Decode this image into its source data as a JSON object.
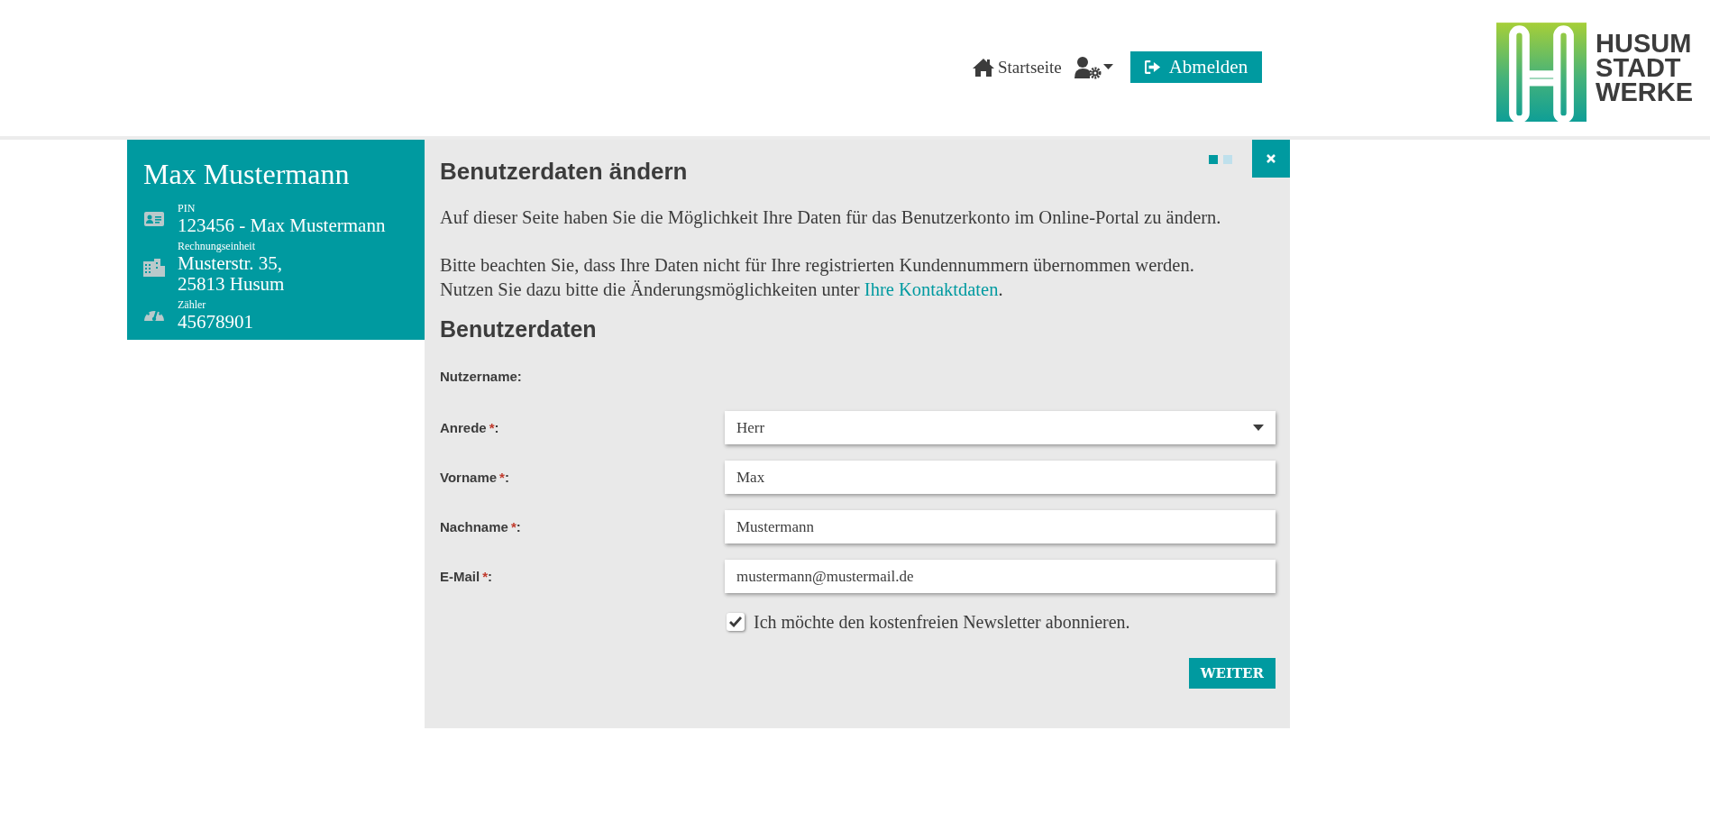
{
  "header": {
    "nav": [
      {
        "kind": "home",
        "label": "Startseite"
      },
      {
        "kind": "user_menu"
      }
    ],
    "logout": {
      "label": "Abmelden"
    },
    "logo": {
      "lines": [
        "HUSUM",
        "STADT",
        "WERKE"
      ]
    }
  },
  "sidebar": {
    "name": "Max Mustermann",
    "items": [
      {
        "kind": "id",
        "label": "PIN",
        "lines": [
          "123456 - Max Mustermann"
        ]
      },
      {
        "kind": "building",
        "label": "Rechnungseinheit",
        "lines": [
          "Musterstr. 35,",
          "25813 Husum"
        ]
      },
      {
        "kind": "meter",
        "label": "Zähler",
        "lines": [
          "45678901"
        ]
      }
    ]
  },
  "panel": {
    "title": "Benutzerdaten ändern",
    "steps": [
      {
        "selected": true
      },
      {
        "selected": false
      }
    ],
    "intro": "Auf dieser Seite haben Sie die Möglichkeit Ihre Daten für das Benutzerkonto im Online-Portal zu ändern.",
    "note": "Bitte beachten Sie, dass Ihre Daten nicht für Ihre registrierten Kundennummern übernommen werden.",
    "note2": "Nutzen Sie dazu bitte die Änderungsmöglichkeiten unter ",
    "link": "Ihre Kontaktdaten",
    "note_end": ".",
    "section": "Benutzerdaten",
    "fields": [
      {
        "kind": "static",
        "label": "Nutzername:"
      },
      {
        "kind": "select",
        "label": "Anrede",
        "mark": "*",
        "suffix": ":",
        "value": "Herr"
      },
      {
        "kind": "text",
        "label": "Vorname",
        "mark": "*",
        "suffix": ":",
        "value": "Max"
      },
      {
        "kind": "text",
        "label": "Nachname",
        "mark": "*",
        "suffix": ":",
        "value": "Mustermann"
      },
      {
        "kind": "text",
        "label": "E-Mail",
        "mark": "*",
        "suffix": ":",
        "value": "mustermann@mustermail.de"
      }
    ],
    "newsletter": {
      "label": "Ich möchte den kostenfreien Newsletter abonnieren.",
      "checked": true
    },
    "submit": "WEITER"
  }
}
